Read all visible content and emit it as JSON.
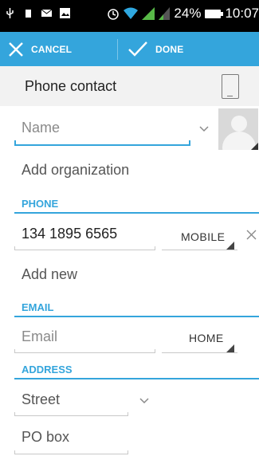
{
  "status_bar": {
    "battery": "24%",
    "time": "10:07"
  },
  "action_bar": {
    "cancel_label": "CANCEL",
    "done_label": "DONE"
  },
  "account": {
    "label": "Phone contact"
  },
  "fields": {
    "name_placeholder": "Name",
    "add_organization": "Add organization",
    "phone_section": "PHONE",
    "phone_value": "134 1895 6565",
    "phone_type": "MOBILE",
    "add_new": "Add new",
    "email_section": "EMAIL",
    "email_placeholder": "Email",
    "email_type": "HOME",
    "address_section": "ADDRESS",
    "street_placeholder": "Street",
    "pobox_placeholder": "PO box"
  },
  "colors": {
    "accent": "#34a5dc",
    "status_bar": "#000000",
    "account_bg": "#f2f2f2"
  }
}
